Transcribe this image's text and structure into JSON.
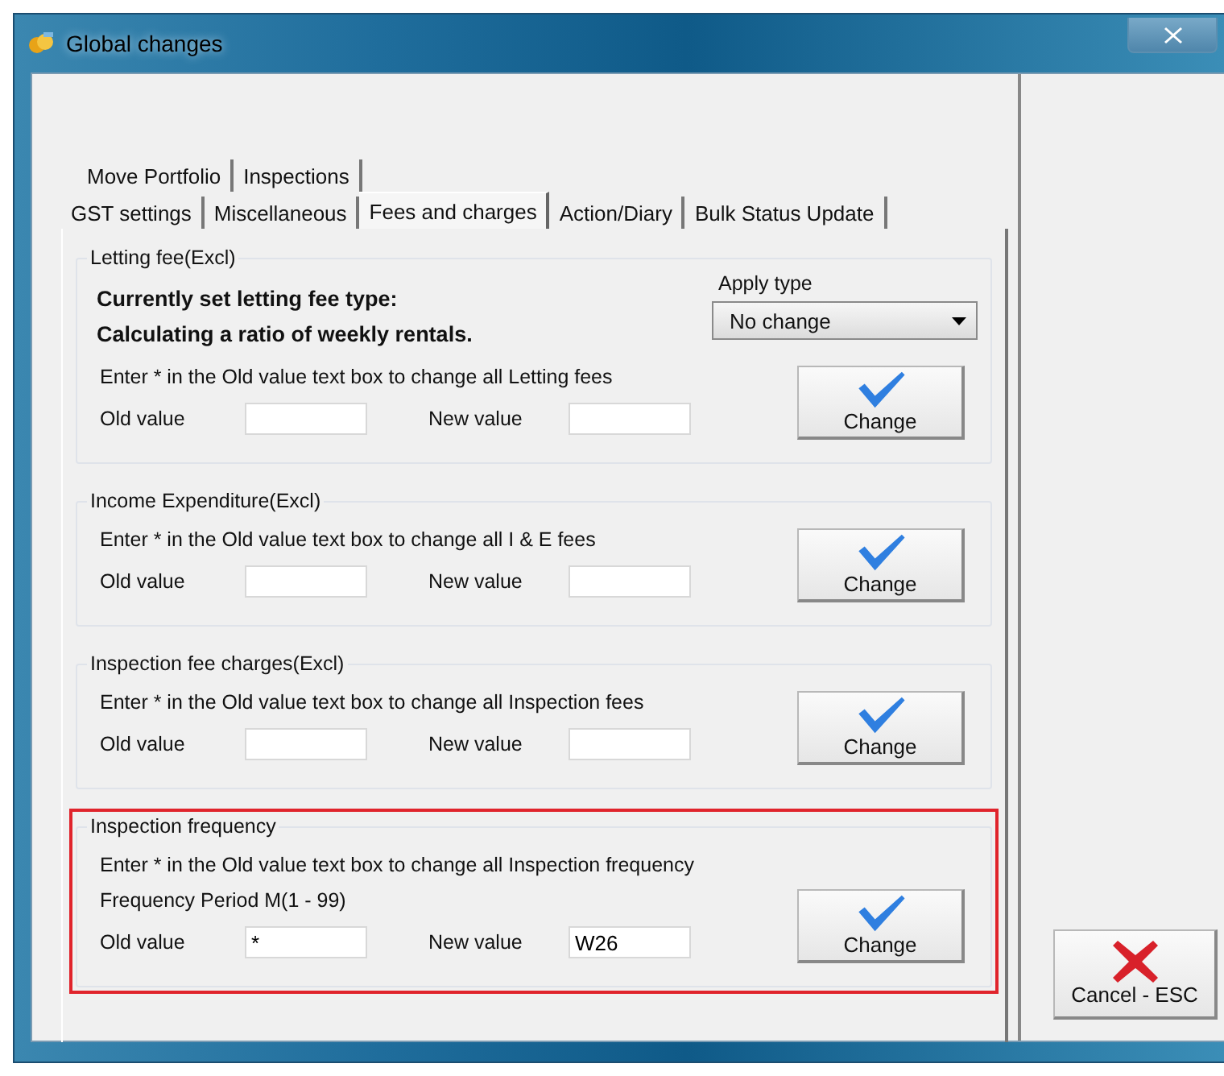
{
  "window": {
    "title": "Global changes"
  },
  "tab_rows": [
    [
      {
        "label": "Move Portfolio",
        "selected": false
      },
      {
        "label": "Inspections",
        "selected": false
      }
    ],
    [
      {
        "label": "GST settings",
        "selected": false
      },
      {
        "label": "Miscellaneous",
        "selected": false
      },
      {
        "label": "Fees and charges",
        "selected": true
      },
      {
        "label": "Action/Diary",
        "selected": false
      },
      {
        "label": "Bulk Status Update",
        "selected": false
      }
    ]
  ],
  "sections": [
    {
      "kind": "letting",
      "title": "Letting fee(Excl)",
      "current_type": [
        "Currently set letting fee type:",
        "Calculating a ratio of weekly rentals."
      ],
      "apply_type": {
        "label": "Apply type",
        "value": "No change"
      },
      "hints": [
        "Enter * in the Old value text box to change all Letting fees"
      ],
      "fields": [
        {
          "label": "Old value"
        },
        {
          "label": "New value"
        }
      ],
      "button": "Change",
      "highlighted": false
    },
    {
      "kind": "plain",
      "title": "Income Expenditure(Excl)",
      "hints": [
        "Enter * in the Old value text box to change all I & E fees"
      ],
      "fields": [
        {
          "label": "Old value"
        },
        {
          "label": "New value"
        }
      ],
      "button": "Change",
      "highlighted": false
    },
    {
      "kind": "plain",
      "title": "Inspection fee charges(Excl)",
      "hints": [
        "Enter * in the Old value text box to change all Inspection fees"
      ],
      "fields": [
        {
          "label": "Old value"
        },
        {
          "label": "New value"
        }
      ],
      "button": "Change",
      "highlighted": false
    },
    {
      "kind": "plain",
      "title": "Inspection frequency",
      "hints": [
        "Enter * in the Old value text box to change all Inspection frequency",
        "Frequency Period M(1 - 99)"
      ],
      "fields": [
        {
          "label": "Old value",
          "value": "*"
        },
        {
          "label": "New value",
          "value": "W26"
        }
      ],
      "button": "Change",
      "highlighted": true
    }
  ],
  "cancel_button": "Cancel - ESC"
}
